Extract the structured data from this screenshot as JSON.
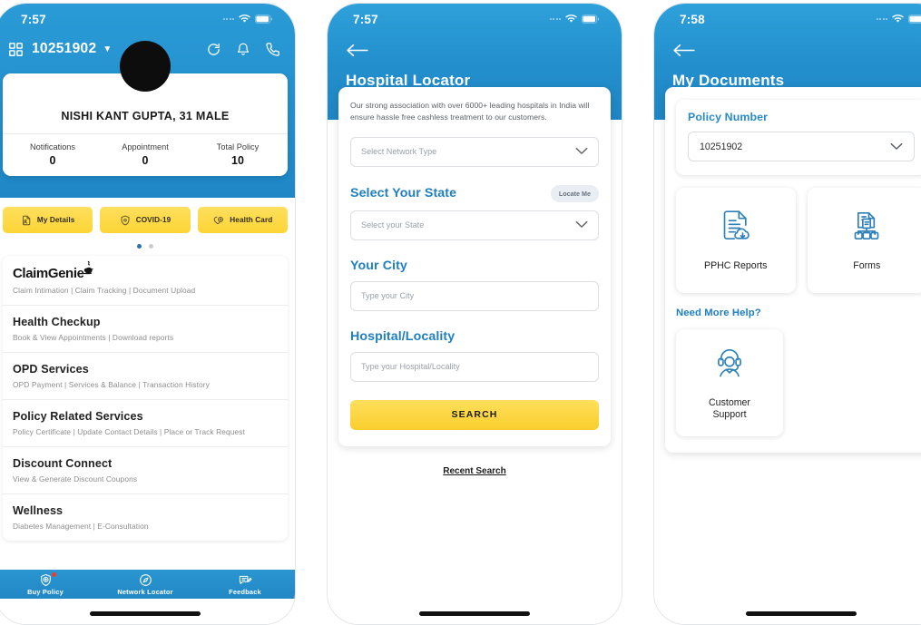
{
  "phone1": {
    "status": {
      "time": "7:57"
    },
    "header": {
      "policy_number": "10251902",
      "qr_icon": "qr-code-icon",
      "refresh_icon": "refresh-icon",
      "bell_icon": "bell-icon",
      "call_icon": "phone-call-icon",
      "dropdown_icon": "caret-down-icon"
    },
    "profile": {
      "name": "NISHI KANT GUPTA, 31 MALE",
      "stats": [
        {
          "label": "Notifications",
          "value": "0"
        },
        {
          "label": "Appointment",
          "value": "0"
        },
        {
          "label": "Total Policy",
          "value": "10"
        }
      ]
    },
    "chips": [
      {
        "label": "My Details",
        "icon": "document-user-icon"
      },
      {
        "label": "COVID-19",
        "icon": "shield-virus-icon"
      },
      {
        "label": "Health Card",
        "icon": "heart-card-icon"
      }
    ],
    "pager": {
      "total": 2,
      "active": 0
    },
    "menu": [
      {
        "title": "ClaimGenie",
        "is_logo": true,
        "subtitle": "Claim Intimation | Claim Tracking | Document Upload"
      },
      {
        "title": "Health Checkup",
        "subtitle": "Book & View Appointments | Download reports"
      },
      {
        "title": "OPD Services",
        "subtitle": "OPD Payment | Services & Balance | Transaction History"
      },
      {
        "title": "Policy Related Services",
        "subtitle": "Policy Certificate | Update Contact Details | Place or Track Request"
      },
      {
        "title": "Discount Connect",
        "subtitle": "View & Generate Discount Coupons"
      },
      {
        "title": "Wellness",
        "subtitle": "Diabetes Management | E-Consultation"
      }
    ],
    "tabs": [
      {
        "label": "Buy Policy",
        "icon": "shield-plus-icon",
        "badge": true
      },
      {
        "label": "Network Locator",
        "icon": "locator-icon",
        "badge": false
      },
      {
        "label": "Feedback",
        "icon": "feedback-icon",
        "badge": false
      }
    ]
  },
  "phone2": {
    "status": {
      "time": "7:57"
    },
    "back_icon": "back-arrow-icon",
    "title": "Hospital Locator",
    "intro": "Our strong association with over 6000+ leading hospitals in India will ensure hassle free cashless treatment to our customers.",
    "network_type": {
      "placeholder": "Select Network Type",
      "value": ""
    },
    "state": {
      "heading": "Select Your State",
      "locate_label": "Locate Me",
      "placeholder": "Select your State",
      "value": ""
    },
    "city": {
      "heading": "Your City",
      "placeholder": "Type your City",
      "value": ""
    },
    "hospital": {
      "heading": "Hospital/Locality",
      "placeholder": "Type your Hospital/Locality",
      "value": ""
    },
    "search_label": "SEARCH",
    "recent_search_label": "Recent Search"
  },
  "phone3": {
    "status": {
      "time": "7:58"
    },
    "back_icon": "back-arrow-icon",
    "title": "My Documents",
    "policy": {
      "label": "Policy Number",
      "value": "10251902"
    },
    "tiles": [
      {
        "label": "PPHC Reports",
        "icon": "document-download-icon"
      },
      {
        "label": "Forms",
        "icon": "forms-hierarchy-icon"
      }
    ],
    "help_label": "Need More Help?",
    "support_tile": {
      "label": "Customer\nSupport",
      "line1": "Customer",
      "line2": "Support",
      "icon": "headset-agent-icon"
    }
  },
  "colors": {
    "brand_blue": "#2390cd",
    "accent_yellow": "#fcd535",
    "link_blue": "#1f7fc0",
    "badge_red": "#ec3b2b"
  }
}
